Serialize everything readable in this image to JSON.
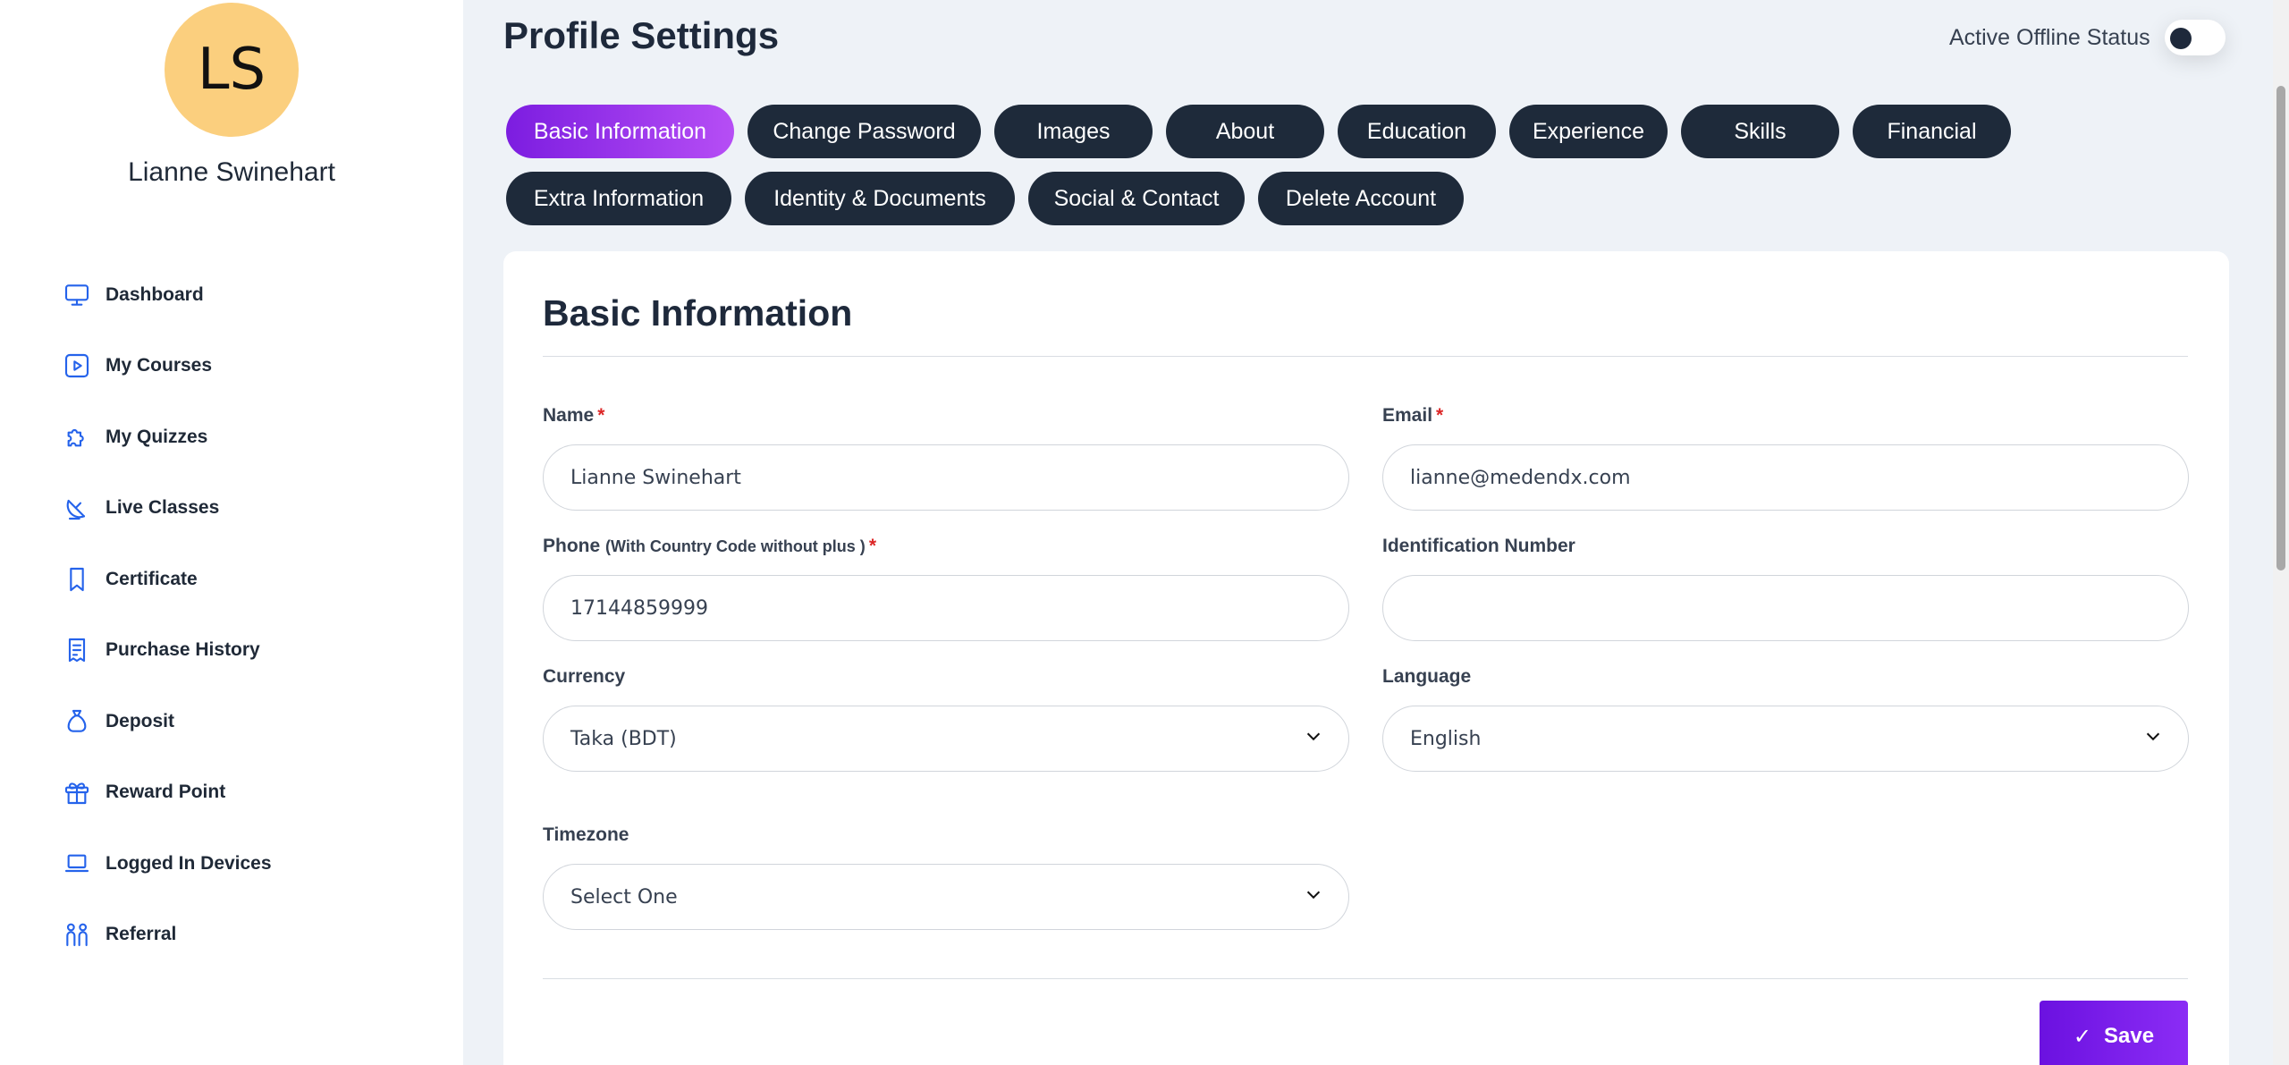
{
  "sidebar": {
    "avatar_initials": "LS",
    "user_name": "Lianne Swinehart",
    "items": [
      {
        "label": "Dashboard",
        "icon": "monitor-icon"
      },
      {
        "label": "My Courses",
        "icon": "play-square-icon"
      },
      {
        "label": "My Quizzes",
        "icon": "puzzle-icon"
      },
      {
        "label": "Live Classes",
        "icon": "satellite-dish-icon"
      },
      {
        "label": "Certificate",
        "icon": "bookmark-icon"
      },
      {
        "label": "Purchase History",
        "icon": "receipt-icon"
      },
      {
        "label": "Deposit",
        "icon": "money-bag-icon"
      },
      {
        "label": "Reward Point",
        "icon": "gift-icon"
      },
      {
        "label": "Logged In Devices",
        "icon": "laptop-icon"
      },
      {
        "label": "Referral",
        "icon": "users-icon"
      }
    ]
  },
  "header": {
    "title": "Profile Settings",
    "status_label": "Active Offline Status"
  },
  "tabs": [
    {
      "label": "Basic Information",
      "active": true
    },
    {
      "label": "Change Password"
    },
    {
      "label": "Images"
    },
    {
      "label": "About"
    },
    {
      "label": "Education"
    },
    {
      "label": "Experience"
    },
    {
      "label": "Skills"
    },
    {
      "label": "Financial"
    },
    {
      "label": "Extra Information"
    },
    {
      "label": "Identity & Documents"
    },
    {
      "label": "Social & Contact"
    },
    {
      "label": "Delete Account"
    }
  ],
  "form": {
    "title": "Basic Information",
    "name": {
      "label": "Name",
      "required": "*",
      "value": "Lianne Swinehart"
    },
    "email": {
      "label": "Email",
      "required": "*",
      "value": "lianne@medendx.com"
    },
    "phone": {
      "label": "Phone",
      "hint": "(With Country Code without plus )",
      "required": "*",
      "value": "17144859999"
    },
    "identification": {
      "label": "Identification Number",
      "value": ""
    },
    "currency": {
      "label": "Currency",
      "value": "Taka (BDT)"
    },
    "language": {
      "label": "Language",
      "value": "English"
    },
    "timezone": {
      "label": "Timezone",
      "value": "Select One"
    },
    "save_label": "Save"
  },
  "colors": {
    "accent": "#7c1de0",
    "tab_bg": "#1e2a3a",
    "icon": "#2563eb",
    "avatar": "#fbcf7e"
  }
}
